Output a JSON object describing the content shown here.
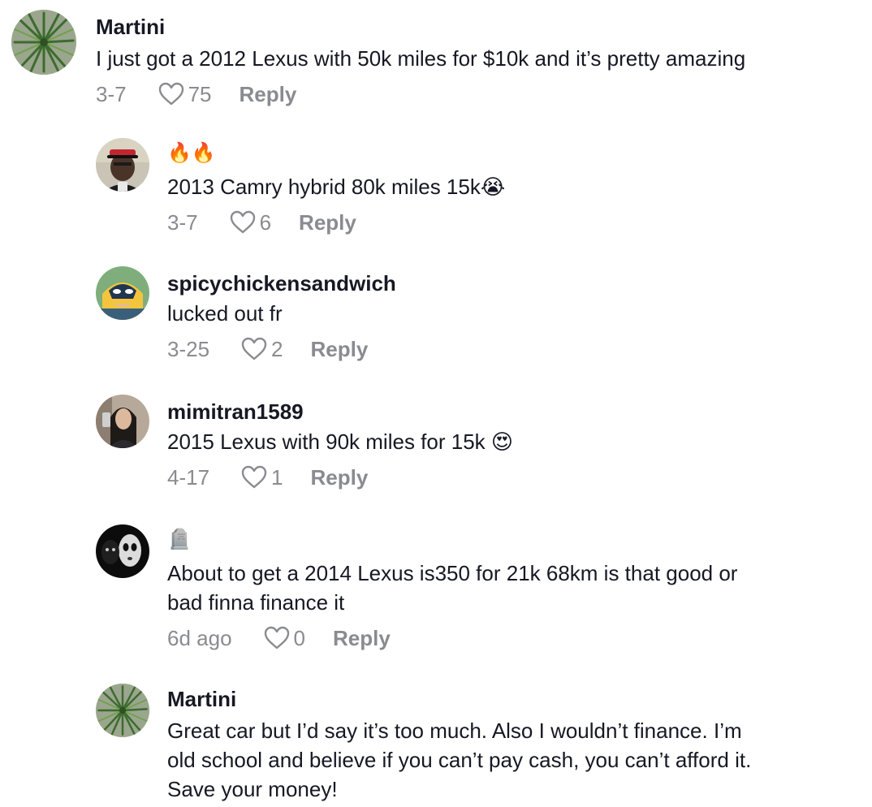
{
  "comments": [
    {
      "username": "Martini",
      "text": "I just got a 2012 Lexus with 50k miles for $10k and it’s pretty amazing",
      "date": "3-7",
      "likes": "75",
      "reply": "Reply",
      "avatar_icon": "yucca-plant-avatar"
    },
    {
      "username": "🔥🔥",
      "text": "2013 Camry hybrid 80k miles 15k😭",
      "date": "3-7",
      "likes": "6",
      "reply": "Reply",
      "avatar_icon": "man-red-cap-avatar"
    },
    {
      "username": "spicychickensandwich",
      "text": "lucked out fr",
      "date": "3-25",
      "likes": "2",
      "reply": "Reply",
      "avatar_icon": "cartoon-hero-avatar"
    },
    {
      "username": "mimitran1589",
      "text": "2015 Lexus with 90k miles for 15k 😍",
      "date": "4-17",
      "likes": "1",
      "reply": "Reply",
      "avatar_icon": "selfie-avatar"
    },
    {
      "username": "🪦",
      "text": "About to get a 2014 Lexus is350 for 21k 68km is that good or\nbad finna finance it",
      "date": "6d ago",
      "likes": "0",
      "reply": "Reply",
      "avatar_icon": "dark-faces-avatar"
    },
    {
      "username": "Martini",
      "text": "Great car but I’d say it’s too much. Also I wouldn’t finance. I’m\nold school and believe if you can’t pay cash, you can’t afford it.\nSave your money!",
      "avatar_icon": "yucca-plant-avatar"
    }
  ],
  "colors": {
    "text": "#161823",
    "meta": "#8a8b91",
    "background": "#ffffff"
  }
}
